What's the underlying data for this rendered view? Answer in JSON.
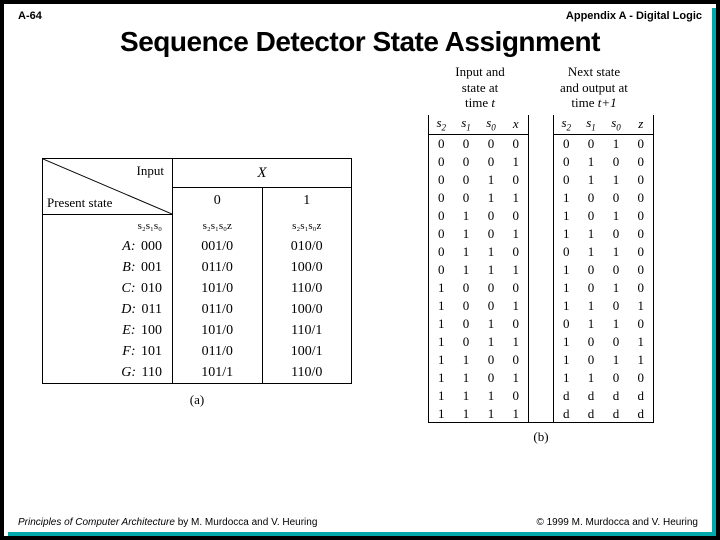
{
  "header": {
    "page_num": "A-64",
    "section": "Appendix A - Digital Logic"
  },
  "title": "Sequence Detector State Assignment",
  "tableA": {
    "diag": {
      "input": "Input",
      "present_state": "Present state",
      "var": "X"
    },
    "cols": [
      "0",
      "1"
    ],
    "subhead": {
      "left": "s₂s₁s₀",
      "c0": "s₂s₁s₀z",
      "c1": "s₂s₁s₀z"
    },
    "rows": [
      {
        "name": "A:",
        "bits": "000",
        "c0": "001/0",
        "c1": "010/0"
      },
      {
        "name": "B:",
        "bits": "001",
        "c0": "011/0",
        "c1": "100/0"
      },
      {
        "name": "C:",
        "bits": "010",
        "c0": "101/0",
        "c1": "110/0"
      },
      {
        "name": "D:",
        "bits": "011",
        "c0": "011/0",
        "c1": "100/0"
      },
      {
        "name": "E:",
        "bits": "100",
        "c0": "101/0",
        "c1": "110/1"
      },
      {
        "name": "F:",
        "bits": "101",
        "c0": "011/0",
        "c1": "100/1"
      },
      {
        "name": "G:",
        "bits": "110",
        "c0": "101/1",
        "c1": "110/0"
      }
    ],
    "caption": "(a)"
  },
  "tableB": {
    "group1": {
      "l1": "Input and",
      "l2": "state at",
      "l3": "time",
      "var": "t"
    },
    "group2": {
      "l1": "Next state",
      "l2": "and output at",
      "l3": "time",
      "var": "t+1"
    },
    "cols_left": [
      "s₂",
      "s₁",
      "s₀",
      "x"
    ],
    "cols_right": [
      "s₂",
      "s₁",
      "s₀",
      "z"
    ],
    "rows": [
      [
        "0",
        "0",
        "0",
        "0",
        "0",
        "0",
        "1",
        "0"
      ],
      [
        "0",
        "0",
        "0",
        "1",
        "0",
        "1",
        "0",
        "0"
      ],
      [
        "0",
        "0",
        "1",
        "0",
        "0",
        "1",
        "1",
        "0"
      ],
      [
        "0",
        "0",
        "1",
        "1",
        "1",
        "0",
        "0",
        "0"
      ],
      [
        "0",
        "1",
        "0",
        "0",
        "1",
        "0",
        "1",
        "0"
      ],
      [
        "0",
        "1",
        "0",
        "1",
        "1",
        "1",
        "0",
        "0"
      ],
      [
        "0",
        "1",
        "1",
        "0",
        "0",
        "1",
        "1",
        "0"
      ],
      [
        "0",
        "1",
        "1",
        "1",
        "1",
        "0",
        "0",
        "0"
      ],
      [
        "1",
        "0",
        "0",
        "0",
        "1",
        "0",
        "1",
        "0"
      ],
      [
        "1",
        "0",
        "0",
        "1",
        "1",
        "1",
        "0",
        "1"
      ],
      [
        "1",
        "0",
        "1",
        "0",
        "0",
        "1",
        "1",
        "0"
      ],
      [
        "1",
        "0",
        "1",
        "1",
        "1",
        "0",
        "0",
        "1"
      ],
      [
        "1",
        "1",
        "0",
        "0",
        "1",
        "0",
        "1",
        "1"
      ],
      [
        "1",
        "1",
        "0",
        "1",
        "1",
        "1",
        "0",
        "0"
      ],
      [
        "1",
        "1",
        "1",
        "0",
        "d",
        "d",
        "d",
        "d"
      ],
      [
        "1",
        "1",
        "1",
        "1",
        "d",
        "d",
        "d",
        "d"
      ]
    ],
    "caption": "(b)"
  },
  "footer": {
    "book": "Principles of Computer Architecture",
    "authors": " by M. Murdocca and V. Heuring",
    "copyright": "© 1999 M. Murdocca and V. Heuring"
  },
  "chart_data": [
    {
      "type": "table",
      "title": "State transition table (a): Present state vs Input X → Next state / output z",
      "columns": [
        "Present state",
        "code s2s1s0",
        "X=0 → s2s1s0/z",
        "X=1 → s2s1s0/z"
      ],
      "rows": [
        [
          "A",
          "000",
          "001/0",
          "010/0"
        ],
        [
          "B",
          "001",
          "011/0",
          "100/0"
        ],
        [
          "C",
          "010",
          "101/0",
          "110/0"
        ],
        [
          "D",
          "011",
          "011/0",
          "100/0"
        ],
        [
          "E",
          "100",
          "101/0",
          "110/1"
        ],
        [
          "F",
          "101",
          "011/0",
          "100/1"
        ],
        [
          "G",
          "110",
          "101/1",
          "110/0"
        ]
      ]
    },
    {
      "type": "table",
      "title": "Truth table (b): Input+state at time t → Next state and output at time t+1",
      "columns": [
        "s2",
        "s1",
        "s0",
        "x",
        "s2'",
        "s1'",
        "s0'",
        "z"
      ],
      "rows": [
        [
          "0",
          "0",
          "0",
          "0",
          "0",
          "0",
          "1",
          "0"
        ],
        [
          "0",
          "0",
          "0",
          "1",
          "0",
          "1",
          "0",
          "0"
        ],
        [
          "0",
          "0",
          "1",
          "0",
          "0",
          "1",
          "1",
          "0"
        ],
        [
          "0",
          "0",
          "1",
          "1",
          "1",
          "0",
          "0",
          "0"
        ],
        [
          "0",
          "1",
          "0",
          "0",
          "1",
          "0",
          "1",
          "0"
        ],
        [
          "0",
          "1",
          "0",
          "1",
          "1",
          "1",
          "0",
          "0"
        ],
        [
          "0",
          "1",
          "1",
          "0",
          "0",
          "1",
          "1",
          "0"
        ],
        [
          "0",
          "1",
          "1",
          "1",
          "1",
          "0",
          "0",
          "0"
        ],
        [
          "1",
          "0",
          "0",
          "0",
          "1",
          "0",
          "1",
          "0"
        ],
        [
          "1",
          "0",
          "0",
          "1",
          "1",
          "1",
          "0",
          "1"
        ],
        [
          "1",
          "0",
          "1",
          "0",
          "0",
          "1",
          "1",
          "0"
        ],
        [
          "1",
          "0",
          "1",
          "1",
          "1",
          "0",
          "0",
          "1"
        ],
        [
          "1",
          "1",
          "0",
          "0",
          "1",
          "0",
          "1",
          "1"
        ],
        [
          "1",
          "1",
          "0",
          "1",
          "1",
          "1",
          "0",
          "0"
        ],
        [
          "1",
          "1",
          "1",
          "0",
          "d",
          "d",
          "d",
          "d"
        ],
        [
          "1",
          "1",
          "1",
          "1",
          "d",
          "d",
          "d",
          "d"
        ]
      ]
    }
  ]
}
